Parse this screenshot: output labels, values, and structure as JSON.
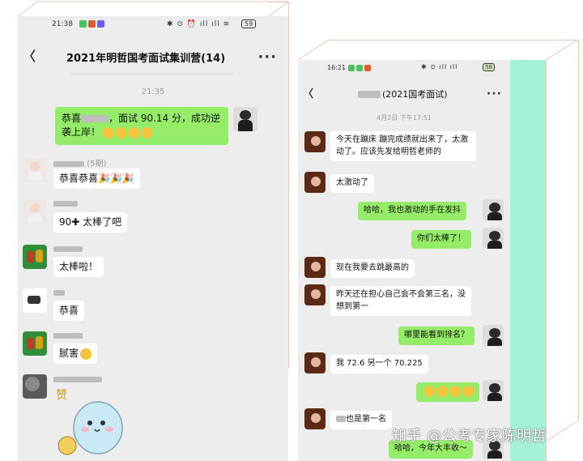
{
  "left_chat": {
    "status": {
      "time": "21:38",
      "icons_text": "✱ ⊙ ⏰ ıll ıll ≋",
      "battery": "59"
    },
    "header": {
      "title": "2021年明哲国考面试集训营(14)",
      "back_label": "〈",
      "more_label": "···"
    },
    "timestamp": "21:35",
    "messages": [
      {
        "side": "right",
        "text": "恭喜",
        "text_after_blur": "，面试 90.14 分，成功逆袭上岸！",
        "avatar": "person"
      },
      {
        "side": "left",
        "nick": "(5期)",
        "text": "恭喜恭喜🎉🎉🎉",
        "avatar": "girl"
      },
      {
        "side": "left",
        "text": "90✚   太棒了吧",
        "avatar": "girl"
      },
      {
        "side": "left",
        "text": "太棒啦！",
        "avatar": "cartoon"
      },
      {
        "side": "left",
        "text": "恭喜",
        "avatar": "whiteicon"
      },
      {
        "side": "left",
        "text": "腻害",
        "avatar": "cartoon"
      }
    ],
    "sticker_text": "赞"
  },
  "right_chat": {
    "status": {
      "time": "16:21",
      "battery": "58"
    },
    "header": {
      "title": "(2021国考面试)",
      "back_label": "〈",
      "more_label": "···"
    },
    "timestamp": "4月2日 下午17:51",
    "messages": [
      {
        "side": "left",
        "text": "今天在蹦床 蹦完成绩就出来了，太激动了。应该先发给明哲老师的"
      },
      {
        "side": "left",
        "text": "太激动了"
      },
      {
        "side": "right",
        "text": "哈哈，我也激动的手在发抖"
      },
      {
        "side": "right",
        "text": "你们太棒了！"
      },
      {
        "side": "left",
        "text": "现在我要去跳最高的"
      },
      {
        "side": "left",
        "text": "昨天还在担心自己会不会第三名，没想到第一"
      },
      {
        "side": "right",
        "text": "哪里能看到排名？"
      },
      {
        "side": "left",
        "text": "我 72.6  另一个 70.225"
      },
      {
        "side": "right",
        "text": ""
      },
      {
        "side": "left",
        "text": "也是第一名"
      },
      {
        "side": "right",
        "text": "哈哈，今年大丰收～"
      }
    ]
  },
  "watermark": "知乎 @公考专家陈明哲",
  "colors": {
    "green_bubble": "#95ec69",
    "chat_bg": "#ededed",
    "teal_panel": "#a6f2d9",
    "frame_line": "#e9c7ba"
  }
}
